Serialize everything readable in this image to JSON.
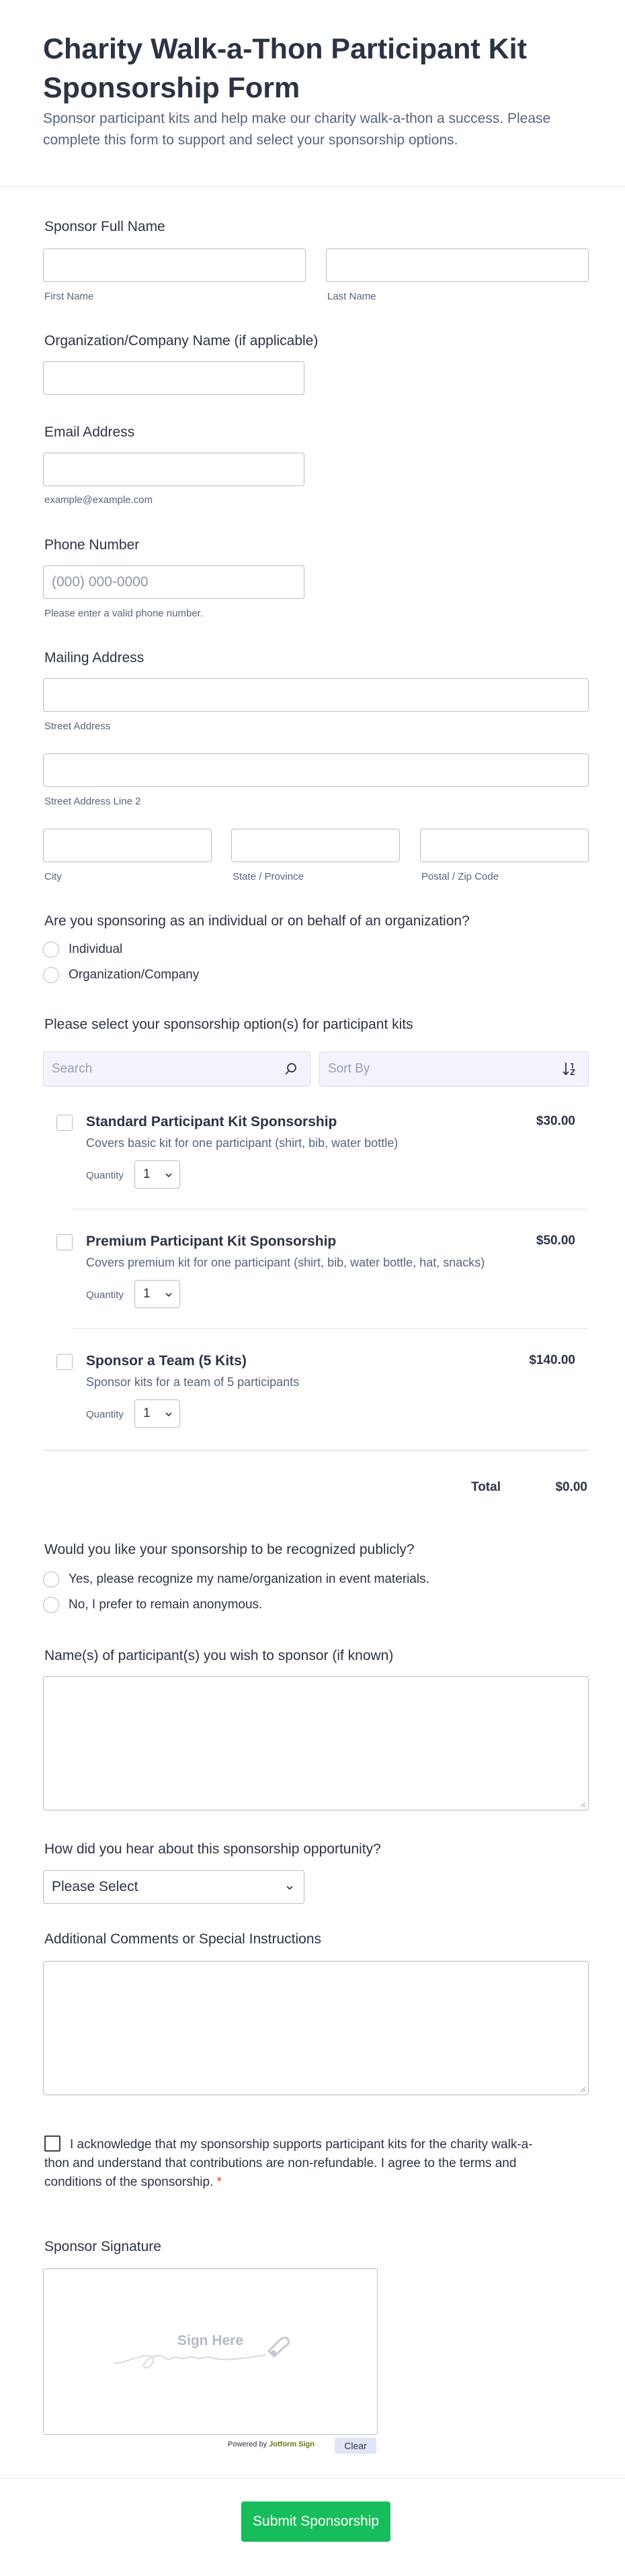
{
  "header": {
    "title": "Charity Walk-a-Thon Participant Kit Sponsorship Form",
    "subtitle": "Sponsor participant kits and help make our charity walk-a-thon a success. Please complete this form to support and select your sponsorship options."
  },
  "sponsor_name": {
    "label": "Sponsor Full Name",
    "first_sublabel": "First Name",
    "last_sublabel": "Last Name"
  },
  "organization": {
    "label": "Organization/Company Name (if applicable)"
  },
  "email": {
    "label": "Email Address",
    "sublabel": "example@example.com"
  },
  "phone": {
    "label": "Phone Number",
    "placeholder": "(000) 000-0000",
    "sublabel": "Please enter a valid phone number."
  },
  "address": {
    "label": "Mailing Address",
    "street": "Street Address",
    "street2": "Street Address Line 2",
    "city": "City",
    "state": "State / Province",
    "zip": "Postal / Zip Code"
  },
  "sponsor_type": {
    "label": "Are you sponsoring as an individual or on behalf of an organization?",
    "options": [
      "Individual",
      "Organization/Company"
    ]
  },
  "products": {
    "label": "Please select your sponsorship option(s) for participant kits",
    "search_placeholder": "Search",
    "sort_placeholder": "Sort By",
    "quantity_label": "Quantity",
    "items": [
      {
        "name": "Standard Participant Kit Sponsorship",
        "desc": "Covers basic kit for one participant (shirt, bib, water bottle)",
        "price": "$30.00",
        "qty": "1"
      },
      {
        "name": "Premium Participant Kit Sponsorship",
        "desc": "Covers premium kit for one participant (shirt, bib, water bottle, hat, snacks)",
        "price": "$50.00",
        "qty": "1"
      },
      {
        "name": "Sponsor a Team (5 Kits)",
        "desc": "Sponsor kits for a team of 5 participants",
        "price": "$140.00",
        "qty": "1"
      }
    ],
    "total_label": "Total",
    "total_value": "$0.00"
  },
  "recognition": {
    "label": "Would you like your sponsorship to be recognized publicly?",
    "options": [
      "Yes, please recognize my name/organization in event materials.",
      "No, I prefer to remain anonymous."
    ]
  },
  "participants": {
    "label": "Name(s) of participant(s) you wish to sponsor (if known)"
  },
  "hear_about": {
    "label": "How did you hear about this sponsorship opportunity?",
    "selected": "Please Select"
  },
  "comments": {
    "label": "Additional Comments or Special Instructions"
  },
  "acknowledge": {
    "text": "I acknowledge that my sponsorship supports participant kits for the charity walk-a-thon and understand that contributions are non-refundable. I agree to the terms and conditions of the sponsorship.",
    "required_mark": "*"
  },
  "signature": {
    "label": "Sponsor Signature",
    "placeholder": "Sign Here",
    "powered_by": "Powered by",
    "brand": "Jotform Sign",
    "clear_label": "Clear"
  },
  "submit_label": "Submit Sponsorship",
  "colors": {
    "accent": "#18bd5b",
    "text": "#2c3345",
    "muted": "#57647e",
    "border": "#b8bdc9",
    "tool_bg": "#f3f3fe"
  },
  "icons": {
    "search": "search-icon",
    "sort": "sort-icon",
    "chevron": "chevron-down-icon",
    "signature": "signature-pen-icon"
  }
}
